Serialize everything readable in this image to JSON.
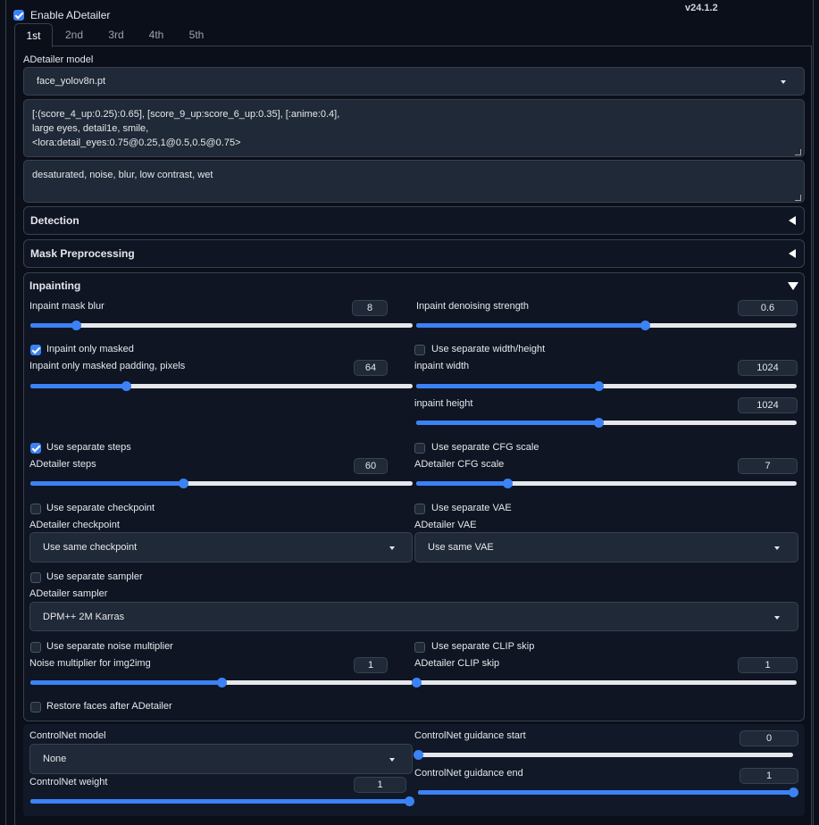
{
  "enable_adetailer": {
    "label": "Enable ADetailer",
    "checked": true
  },
  "version": "v24.1.2",
  "tabs": [
    "1st",
    "2nd",
    "3rd",
    "4th",
    "5th"
  ],
  "active_tab": "1st",
  "model": {
    "label": "ADetailer model",
    "value": "face_yolov8n.pt"
  },
  "prompt": "[:(score_4_up:0.25):0.65], [score_9_up:score_6_up:0.35], [:anime:0.4],\nlarge eyes, detail1e, smile,\n<lora:detail_eyes:0.75@0.25,1@0.5,0.5@0.75>",
  "negative_prompt": "desaturated, noise, blur, low contrast, wet",
  "accordions": {
    "detection": "Detection",
    "mask_preprocessing": "Mask Preprocessing",
    "inpainting": "Inpainting"
  },
  "inpainting": {
    "mask_blur": {
      "label": "Inpaint mask blur",
      "value": "8",
      "fraction": 0.12
    },
    "denoising": {
      "label": "Inpaint denoising strength",
      "value": "0.6",
      "fraction": 0.6
    },
    "only_masked": {
      "label": "Inpaint only masked",
      "checked": true
    },
    "separate_wh": {
      "label": "Use separate width/height",
      "checked": false
    },
    "padding": {
      "label": "Inpaint only masked padding, pixels",
      "value": "64",
      "fraction": 0.25
    },
    "width": {
      "label": "inpaint width",
      "value": "1024",
      "fraction": 0.48
    },
    "height": {
      "label": "inpaint height",
      "value": "1024",
      "fraction": 0.48
    },
    "separate_steps": {
      "label": "Use separate steps",
      "checked": true
    },
    "separate_cfg": {
      "label": "Use separate CFG scale",
      "checked": false
    },
    "steps": {
      "label": "ADetailer steps",
      "value": "60",
      "fraction": 0.4
    },
    "cfg": {
      "label": "ADetailer CFG scale",
      "value": "7",
      "fraction": 0.24
    },
    "separate_checkpoint": {
      "label": "Use separate checkpoint",
      "checked": false
    },
    "separate_vae": {
      "label": "Use separate VAE",
      "checked": false
    },
    "checkpoint": {
      "label": "ADetailer checkpoint",
      "value": "Use same checkpoint"
    },
    "vae": {
      "label": "ADetailer VAE",
      "value": "Use same VAE"
    },
    "separate_sampler": {
      "label": "Use separate sampler",
      "checked": false
    },
    "sampler": {
      "label": "ADetailer sampler",
      "value": "DPM++ 2M Karras"
    },
    "separate_noise": {
      "label": "Use separate noise multiplier",
      "checked": false
    },
    "separate_clip": {
      "label": "Use separate CLIP skip",
      "checked": false
    },
    "noise": {
      "label": "Noise multiplier for img2img",
      "value": "1",
      "fraction": 0.5
    },
    "clip_skip": {
      "label": "ADetailer CLIP skip",
      "value": "1",
      "fraction": 0.0
    },
    "restore_faces": {
      "label": "Restore faces after ADetailer",
      "checked": false
    }
  },
  "controlnet": {
    "model": {
      "label": "ControlNet model",
      "value": "None"
    },
    "weight": {
      "label": "ControlNet weight",
      "value": "1",
      "fraction": 1.0
    },
    "guidance_start": {
      "label": "ControlNet guidance start",
      "value": "0",
      "fraction": 0.0
    },
    "guidance_end": {
      "label": "ControlNet guidance end",
      "value": "1",
      "fraction": 1.0
    }
  },
  "colors": {
    "accent": "#3b82f6",
    "background": "#0b0f19"
  }
}
